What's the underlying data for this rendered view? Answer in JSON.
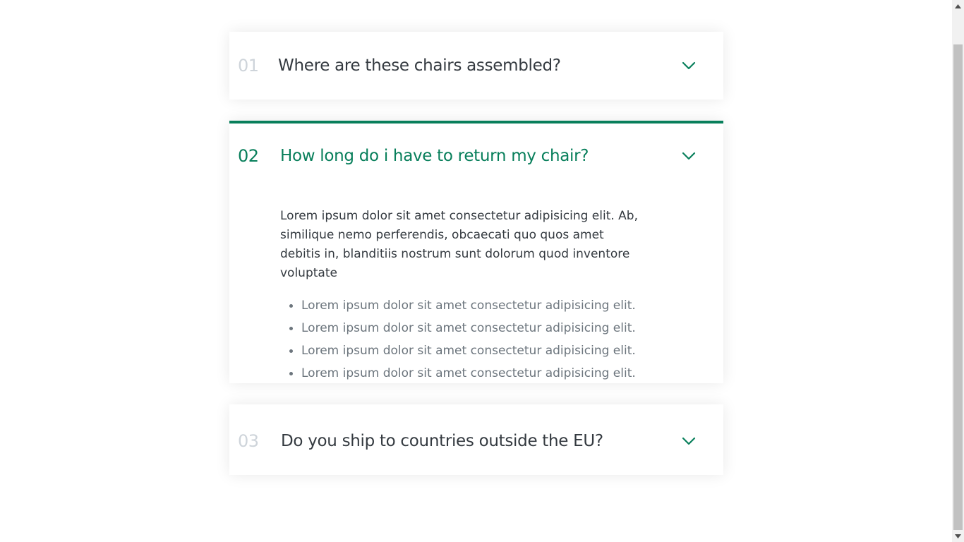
{
  "accordion": {
    "items": [
      {
        "number": "01",
        "title": "Where are these chairs assembled?",
        "open": false
      },
      {
        "number": "02",
        "title": "How long do i have to return my chair?",
        "open": true,
        "text": "Lorem ipsum dolor sit amet consectetur adipisicing elit. Ab, similique nemo perferendis, obcaecati quo quos amet debitis in, blanditiis nostrum sunt dolorum quod inventore voluptate",
        "list": [
          "Lorem ipsum dolor sit amet consectetur adipisicing elit.",
          "Lorem ipsum dolor sit amet consectetur adipisicing elit.",
          "Lorem ipsum dolor sit amet consectetur adipisicing elit.",
          "Lorem ipsum dolor sit amet consectetur adipisicing elit."
        ]
      },
      {
        "number": "03",
        "title": "Do you ship to countries outside the EU?",
        "open": false
      }
    ]
  },
  "icons": {
    "toggle": "chevron-down-icon",
    "scroll_up": "scroll-up-arrow-icon",
    "scroll_down": "scroll-down-arrow-icon"
  },
  "colors": {
    "accent": "#087f5b",
    "number_inactive": "#ced4da",
    "text": "#343a40",
    "list_text": "#6c757d"
  }
}
